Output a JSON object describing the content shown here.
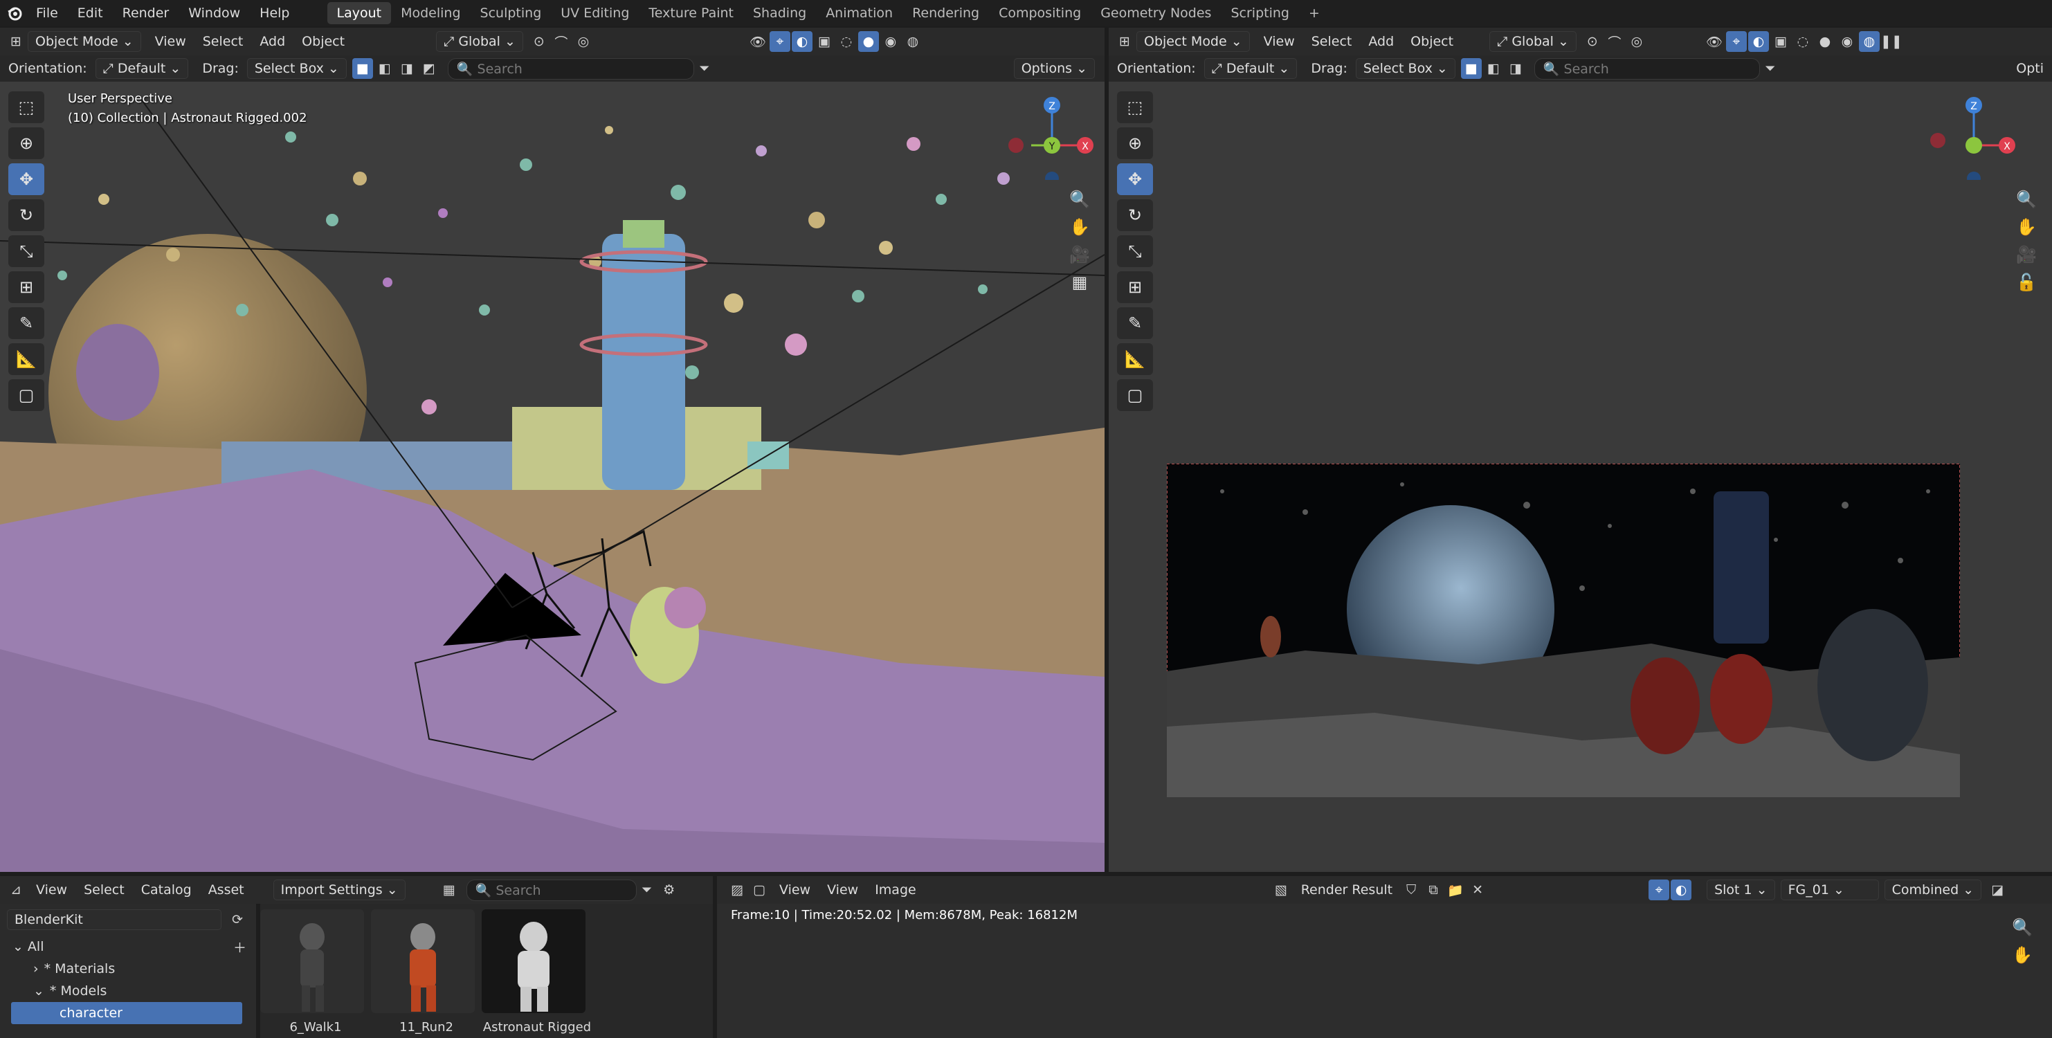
{
  "menubar": {
    "menus": [
      "File",
      "Edit",
      "Render",
      "Window",
      "Help"
    ],
    "workspaces": [
      "Layout",
      "Modeling",
      "Sculpting",
      "UV Editing",
      "Texture Paint",
      "Shading",
      "Animation",
      "Rendering",
      "Compositing",
      "Geometry Nodes",
      "Scripting"
    ],
    "active_workspace": "Layout",
    "add_tab": "+"
  },
  "left_viewport": {
    "mode": "Object Mode",
    "menus": [
      "View",
      "Select",
      "Add",
      "Object"
    ],
    "transform_space": "Global",
    "orientation_label": "Orientation:",
    "orientation_value": "Default",
    "drag_label": "Drag:",
    "drag_value": "Select Box",
    "search_placeholder": "Search",
    "options_label": "Options",
    "overlay_line1": "User Perspective",
    "overlay_line2": "(10) Collection | Astronaut Rigged.002",
    "gizmo": {
      "z": "Z",
      "y": "Y",
      "x": "X"
    }
  },
  "right_viewport": {
    "mode": "Object Mode",
    "menus": [
      "View",
      "Select",
      "Add",
      "Object"
    ],
    "transform_space": "Global",
    "orientation_label": "Orientation:",
    "orientation_value": "Default",
    "drag_label": "Drag:",
    "drag_value": "Select Box",
    "search_placeholder": "Search",
    "options_label": "Opti",
    "gizmo": {
      "z": "Z",
      "x": "X"
    }
  },
  "asset_browser": {
    "menus": [
      "View",
      "Select",
      "Catalog",
      "Asset"
    ],
    "import_settings": "Import Settings",
    "search_placeholder": "Search",
    "library": "BlenderKit",
    "tree": [
      {
        "label": "All",
        "level": 0
      },
      {
        "label": "* Materials",
        "level": 1
      },
      {
        "label": "* Models",
        "level": 1
      },
      {
        "label": "character",
        "level": 2
      }
    ],
    "assets": [
      "6_Walk1",
      "11_Run2",
      "Astronaut Rigged"
    ]
  },
  "image_editor": {
    "menus": [
      "View",
      "View",
      "Image"
    ],
    "image_name": "Render Result",
    "slot": "Slot 1",
    "layer": "FG_01",
    "pass": "Combined",
    "status": "Frame:10 | Time:20:52.02 | Mem:8678M, Peak: 16812M"
  },
  "colors": {
    "accent": "#4772b3",
    "header_bg": "#2a2a2a",
    "viewport_bg": "#3d3d3d",
    "terrain_purple": "#9b7fb0",
    "terrain_tan": "#a28868",
    "gizmo_x": "#e04050",
    "gizmo_y": "#8cc63e",
    "gizmo_z": "#3f82d9"
  }
}
